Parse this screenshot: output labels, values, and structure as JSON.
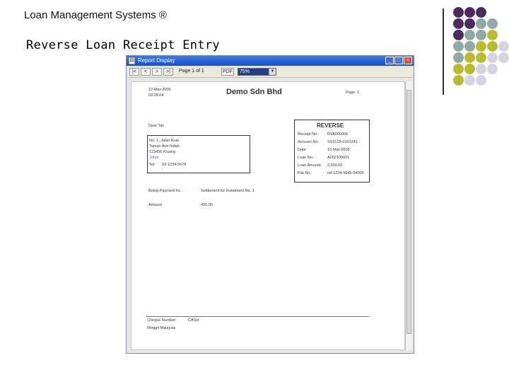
{
  "slide": {
    "title": "Loan Management Systems ®",
    "subtitle": "Reverse Loan Receipt Entry"
  },
  "decor_colors": {
    "purple": "#4e2a5e",
    "teal": "#8fa8a8",
    "olive": "#b8bd2e",
    "lavender": "#d6d4e2"
  },
  "window": {
    "title": "Report Display",
    "app_icon": "report-icon",
    "buttons": {
      "minimize": "_",
      "maximize": "□",
      "close": "×"
    }
  },
  "toolbar": {
    "first": "|<",
    "prev": "<",
    "next": ">",
    "last": ">|",
    "page_label": "Page 1 of 1",
    "export": "PDF",
    "zoom": "75%"
  },
  "report": {
    "date_line1": "12-Mar-2009",
    "date_line2": "03:28:04",
    "company": "Demo Sdn Bhd",
    "page": "Page: 1",
    "dear": "Dear   Tan",
    "address": {
      "line1": "No. 1, Jalan Kuia",
      "line2": "Taman Alor Indah",
      "line3": "123456        Kluang",
      "line4": "Johor",
      "tel_label": "Tel:",
      "tel_value": "03-1234-5678"
    },
    "reverse": {
      "heading": "REVERSE",
      "rows": [
        {
          "label": "Receipt No.:",
          "value": "RVA000006"
        },
        {
          "label": "Account No:",
          "value": "SS3128-0101241"
        },
        {
          "label": "Date:",
          "value": "10-Mar-2009"
        },
        {
          "label": "Loan No.:",
          "value": "A002100001"
        },
        {
          "label": "Loan Amount:",
          "value": "2,600.00"
        },
        {
          "label": "File No.:",
          "value": "ref-1234-5645-54006"
        }
      ]
    },
    "payment_for_label": "Being Payment for...",
    "payment_for_value": "Settlement for Instalment No. 1",
    "amount_label": "Amount",
    "amount_value": "435.00",
    "cheque_label": "Cheque Number:",
    "cheque_value": "CASH",
    "footer": "Ringgit Malaysia"
  }
}
